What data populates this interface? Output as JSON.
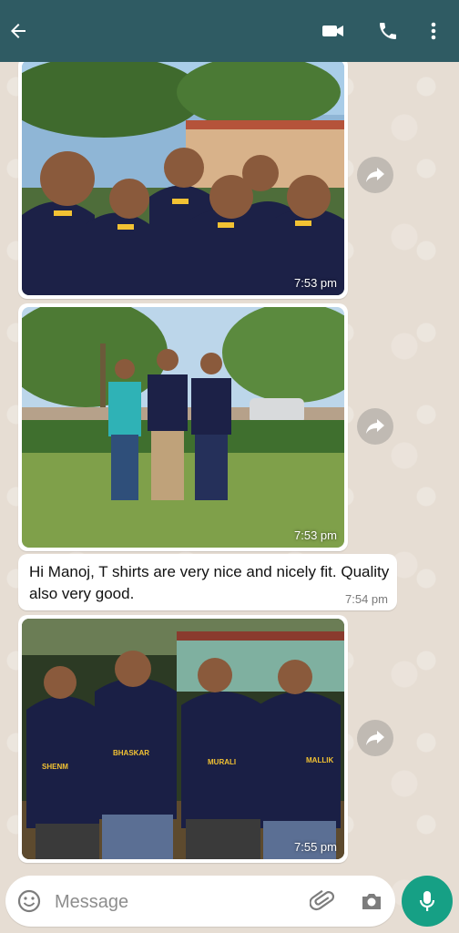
{
  "header": {
    "back_icon": "arrow-left-icon",
    "video_icon": "video-call-icon",
    "call_icon": "phone-icon",
    "menu_icon": "more-vertical-icon"
  },
  "messages": [
    {
      "type": "image",
      "description": "group photo",
      "time": "7:53 pm"
    },
    {
      "type": "image",
      "description": "three people on lawn",
      "time": "7:53 pm"
    },
    {
      "type": "text",
      "text": "Hi Manoj, T shirts are very nice and nicely fit. Quality also very good.",
      "time": "7:54 pm"
    },
    {
      "type": "image",
      "description": "group from behind",
      "time": "7:55 pm"
    }
  ],
  "shirt_names": [
    "SHENM",
    "BHASKAR",
    "MURALI",
    "MALLIK"
  ],
  "composer": {
    "placeholder": "Message",
    "emoji_icon": "emoji-icon",
    "attach_icon": "paperclip-icon",
    "camera_icon": "camera-icon",
    "mic_icon": "mic-icon"
  },
  "colors": {
    "header": "#2f5b63",
    "accent": "#16a085",
    "bubble": "#ffffff",
    "wallpaper": "#e6ddd3"
  }
}
